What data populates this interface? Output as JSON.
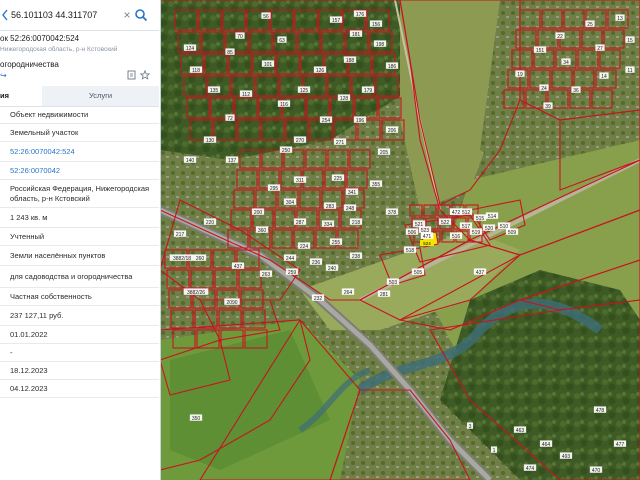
{
  "search": {
    "value": "56.101103 44.311707",
    "close_glyph": "×"
  },
  "card": {
    "title": "ок 52:26:0070042:524",
    "address": "Нижегородская область, р-н Кстовский",
    "category": "огородничества",
    "share_glyph": "↪"
  },
  "tabs": {
    "active": "ия",
    "inactive": "Услуги"
  },
  "rows": [
    {
      "text": "Объект недвижимости",
      "link": false
    },
    {
      "text": "Земельный участок",
      "link": false
    },
    {
      "text": "52:26:0070042:524",
      "link": true
    },
    {
      "text": "52:26:0070042",
      "link": true
    },
    {
      "text": "Российская Федерация, Нижегородская область, р-н Кстовский",
      "link": false
    },
    {
      "text": "1 243 кв. м",
      "link": false
    },
    {
      "text": "Учтенный",
      "link": false
    },
    {
      "text": "Земли населённых пунктов",
      "link": false
    },
    {
      "text": "для садоводства и огородничества",
      "link": false
    },
    {
      "text": "Частная собственность",
      "link": false
    },
    {
      "text": "237 127,11 руб.",
      "link": false
    },
    {
      "text": "01.01.2022",
      "link": false
    },
    {
      "text": "-",
      "link": false
    },
    {
      "text": "18.12.2023",
      "link": false
    },
    {
      "text": "04.12.2023",
      "link": false
    }
  ],
  "map": {
    "colors": {
      "boundary": "#c8141e",
      "selected": "#f2e600",
      "label_bg": "#ffffff"
    },
    "labels": [
      "525",
      "524",
      "522",
      "521",
      "523",
      "518",
      "519",
      "520",
      "517",
      "516",
      "515",
      "514",
      "512",
      "510",
      "509",
      "437",
      "506",
      "505",
      "503",
      "2090",
      "3882/18",
      "437",
      "3882/26",
      "350",
      "360",
      "250",
      "311",
      "271",
      "254",
      "270",
      "283",
      "341",
      "355",
      "378",
      "295",
      "304",
      "334",
      "236",
      "260",
      "217",
      "263",
      "220",
      "200",
      "224",
      "232",
      "240",
      "218",
      "238",
      "264",
      "281",
      "244",
      "255",
      "248",
      "259",
      "287",
      "225",
      "205",
      "206",
      "196",
      "179",
      "188",
      "198",
      "181",
      "186",
      "176",
      "156",
      "157",
      "118",
      "135",
      "85",
      "101",
      "124",
      "70",
      "56",
      "63",
      "72",
      "112",
      "116",
      "125",
      "126",
      "128",
      "130",
      "137",
      "140",
      "151",
      "22",
      "25",
      "27",
      "34",
      "24",
      "36",
      "39",
      "19",
      "14",
      "13",
      "15",
      "11",
      "3",
      "1",
      "474",
      "477",
      "478",
      "470",
      "463",
      "464",
      "493",
      "471",
      "472"
    ]
  }
}
